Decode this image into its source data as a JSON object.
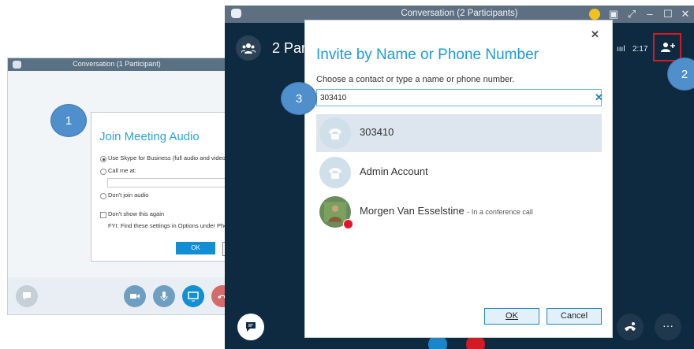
{
  "window1": {
    "title": "Conversation (1 Participant)",
    "join_dialog": {
      "title": "Join Meeting Audio",
      "options": [
        "Use Skype for Business (full audio and video",
        "Call me at:",
        "Don't join audio"
      ],
      "dont_show_label": "Don't show this again",
      "fyi_text": "FYI: Find these settings in Options under Pho",
      "ok_label": "OK"
    }
  },
  "window2": {
    "title": "Conversation (2 Participants)",
    "participants_label": "2 Par",
    "timer": "2:17",
    "signal": "ıııl",
    "more_label": "···"
  },
  "invite_dialog": {
    "title": "Invite by Name or Phone Number",
    "subtitle": "Choose a contact or type a name or phone number.",
    "search_value": "303410",
    "clear_label": "✕",
    "close_label": "✕",
    "contacts": [
      {
        "name": "303410",
        "status": ""
      },
      {
        "name": "Admin Account",
        "status": ""
      },
      {
        "name": "Morgen Van Esselstine",
        "status": "- In a conference call"
      }
    ],
    "ok_label": "OK",
    "cancel_label": "Cancel"
  },
  "steps": [
    "1",
    "2",
    "3"
  ],
  "colors": {
    "accent": "#1a9bd7",
    "dark_bg": "#0e2a40",
    "callout": "#4f8fcb",
    "highlight_box": "#d21b24",
    "presence_busy": "#e2152d"
  }
}
